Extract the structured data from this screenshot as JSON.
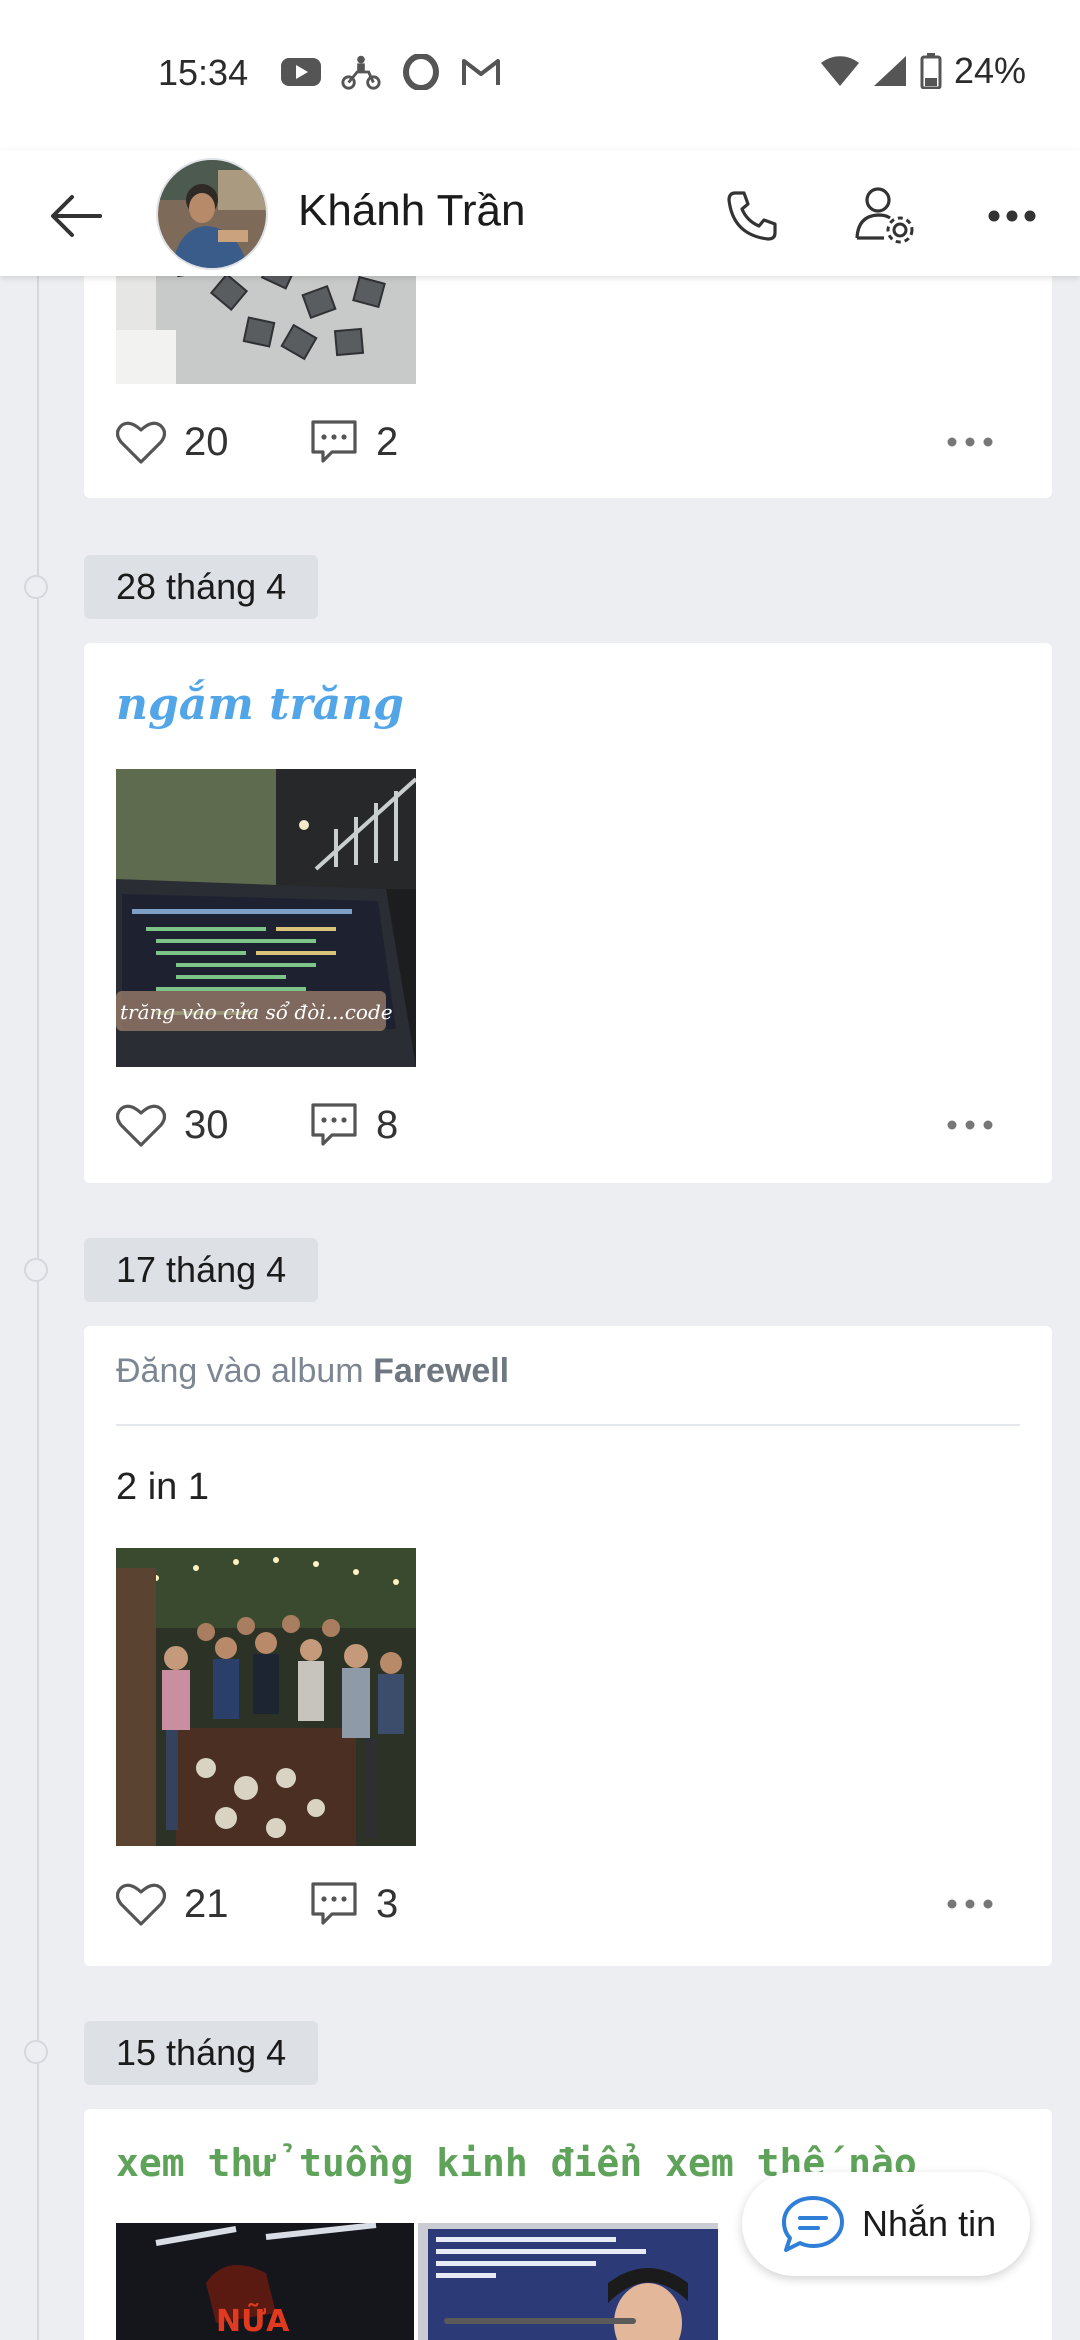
{
  "status_bar": {
    "time": "15:34",
    "battery": "24%",
    "icons": [
      "youtube-icon",
      "delivery-bike-icon",
      "opera-icon",
      "gmail-icon",
      "wifi-icon",
      "signal-icon",
      "battery-icon"
    ]
  },
  "header": {
    "name": "Khánh Trần"
  },
  "posts": [
    {
      "likes": "20",
      "comments": "2"
    },
    {
      "date": "28 tháng 4",
      "title": "ngắm trăng",
      "photo_caption": "trăng vào cửa sổ đòi...code",
      "likes": "30",
      "comments": "8"
    },
    {
      "date": "17 tháng 4",
      "album_prefix": "Đăng vào album",
      "album_name": "Farewell",
      "text": "2 in 1",
      "likes": "21",
      "comments": "3"
    },
    {
      "date": "15 tháng 4",
      "title": "xem thử tuồng kinh điển xem thế nào"
    }
  ],
  "chat_button": {
    "label": "Nhắn tin"
  },
  "colors": {
    "accent_blue": "#52a6e8",
    "accent_green": "#5fa35a",
    "background": "#eceef1"
  }
}
